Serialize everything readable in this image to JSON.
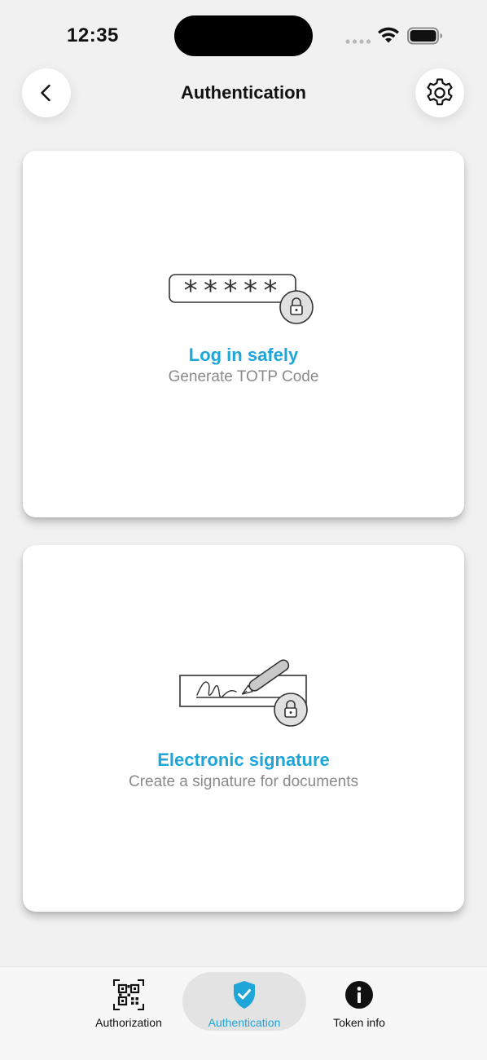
{
  "status_bar": {
    "time": "12:35"
  },
  "header": {
    "title": "Authentication",
    "back_icon": "chevron-left-icon",
    "settings_icon": "gear-icon"
  },
  "cards": [
    {
      "title": "Log in safely",
      "subtitle": "Generate TOTP Code",
      "illustration": "password-lock-icon",
      "password_mask": "*****"
    },
    {
      "title": "Electronic signature",
      "subtitle": "Create a signature for documents",
      "illustration": "signature-pen-lock-icon"
    }
  ],
  "tabs": [
    {
      "label": "Authorization",
      "icon": "qr-code-icon",
      "active": false
    },
    {
      "label": "Authentication",
      "icon": "shield-check-icon",
      "active": true
    },
    {
      "label": "Token info",
      "icon": "info-icon",
      "active": false
    }
  ],
  "colors": {
    "accent": "#1ea6d8",
    "subtitle": "#8a8a8a",
    "background": "#f1f1f1",
    "card": "#ffffff",
    "active_tab": "#e3e3e3"
  }
}
